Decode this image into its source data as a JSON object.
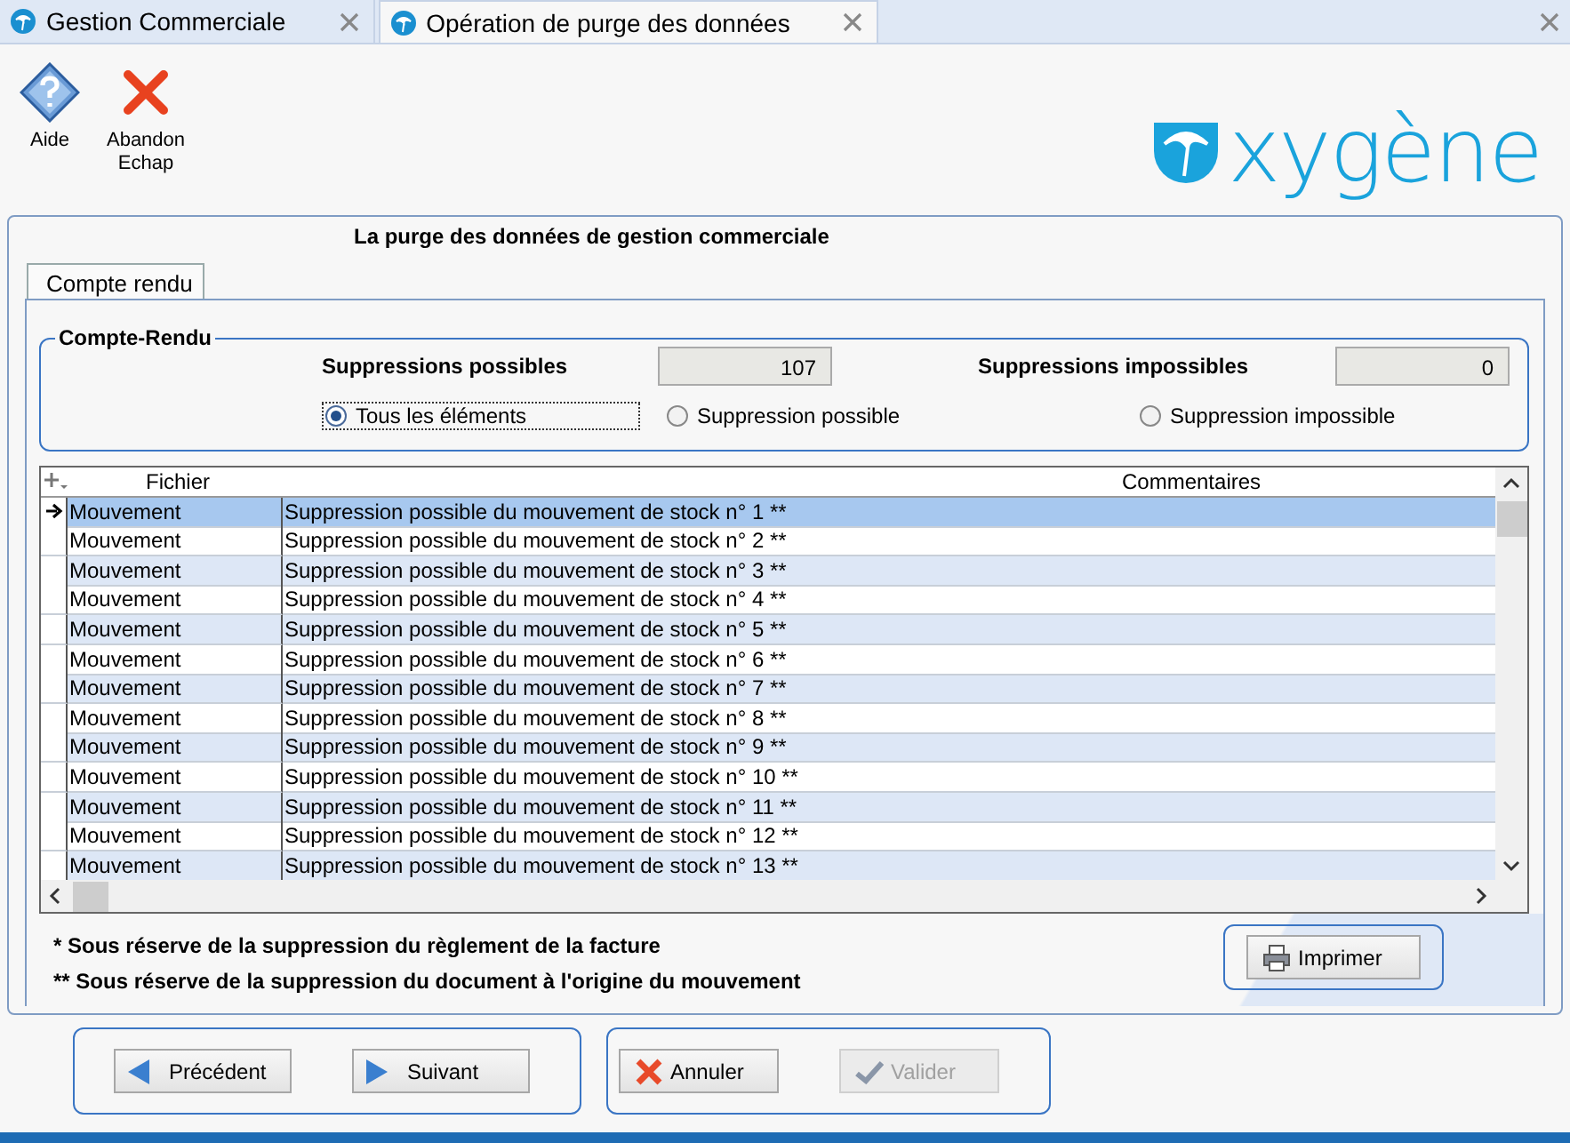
{
  "tabs": [
    {
      "label": "Gestion Commerciale",
      "selected": false
    },
    {
      "label": "Opération de purge des données",
      "selected": true
    }
  ],
  "toolbar": [
    {
      "label": "Aide",
      "kind": "help"
    },
    {
      "label": "Abandon\nEchap",
      "kind": "cancel"
    }
  ],
  "logo": "xygène",
  "title": "La purge des données de gestion commerciale",
  "panel_tab": {
    "label": "Compte rendu",
    "selected": true
  },
  "group": {
    "title": "Compte-Rendu",
    "fields": [
      {
        "label": "Suppressions possibles",
        "value": "107"
      },
      {
        "label": "Suppressions impossibles",
        "value": "0"
      }
    ],
    "filters": [
      {
        "label": "Tous les éléments",
        "selected": true
      },
      {
        "label": "Suppression possible",
        "selected": false
      },
      {
        "label": "Suppression impossible",
        "selected": false
      }
    ]
  },
  "grid": {
    "columns": [
      "Fichier",
      "Commentaires"
    ],
    "rows": [
      {
        "fichier": "Mouvement",
        "commentaire": "Suppression possible du mouvement de stock n° 1 **",
        "selected": true
      },
      {
        "fichier": "Mouvement",
        "commentaire": "Suppression possible du mouvement de stock n° 2 **",
        "selected": false
      },
      {
        "fichier": "Mouvement",
        "commentaire": "Suppression possible du mouvement de stock n° 3 **",
        "selected": false
      },
      {
        "fichier": "Mouvement",
        "commentaire": "Suppression possible du mouvement de stock n° 4 **",
        "selected": false
      },
      {
        "fichier": "Mouvement",
        "commentaire": "Suppression possible du mouvement de stock n° 5 **",
        "selected": false
      },
      {
        "fichier": "Mouvement",
        "commentaire": "Suppression possible du mouvement de stock n° 6 **",
        "selected": false
      },
      {
        "fichier": "Mouvement",
        "commentaire": "Suppression possible du mouvement de stock n° 7 **",
        "selected": false
      },
      {
        "fichier": "Mouvement",
        "commentaire": "Suppression possible du mouvement de stock n° 8 **",
        "selected": false
      },
      {
        "fichier": "Mouvement",
        "commentaire": "Suppression possible du mouvement de stock n° 9 **",
        "selected": false
      },
      {
        "fichier": "Mouvement",
        "commentaire": "Suppression possible du mouvement de stock n° 10 **",
        "selected": false
      },
      {
        "fichier": "Mouvement",
        "commentaire": "Suppression possible du mouvement de stock n° 11 **",
        "selected": false
      },
      {
        "fichier": "Mouvement",
        "commentaire": "Suppression possible du mouvement de stock n° 12 **",
        "selected": false
      },
      {
        "fichier": "Mouvement",
        "commentaire": "Suppression possible du mouvement de stock n° 13 **",
        "selected": false
      }
    ]
  },
  "notes": [
    "* Sous réserve de la suppression du règlement de la facture",
    "** Sous réserve de la suppression du document à l'origine du mouvement"
  ],
  "print_button": "Imprimer",
  "nav_buttons": [
    {
      "label": "Précédent",
      "kind": "previous",
      "disabled": false
    },
    {
      "label": "Suivant",
      "kind": "next",
      "disabled": false
    }
  ],
  "action_buttons": [
    {
      "label": "Annuler",
      "kind": "cancel",
      "disabled": false
    },
    {
      "label": "Valider",
      "kind": "validate",
      "disabled": true
    }
  ]
}
